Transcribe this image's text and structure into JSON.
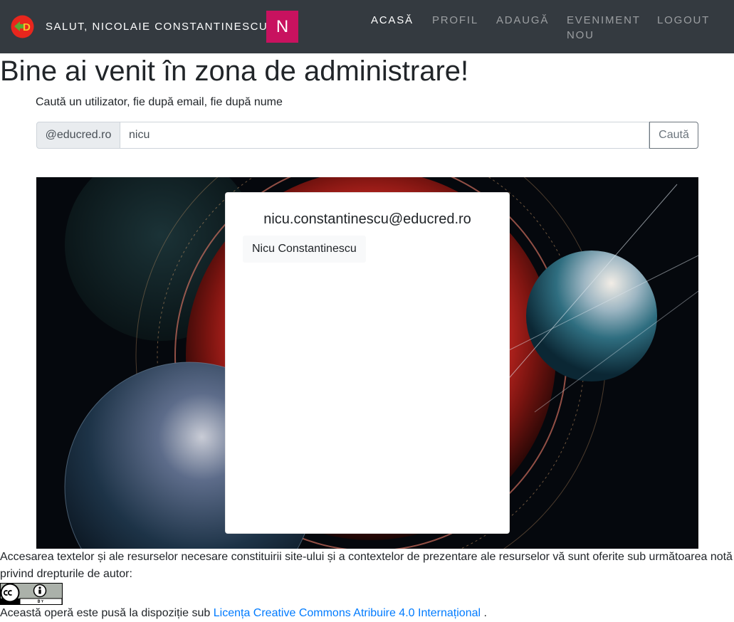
{
  "header": {
    "logo_icon": "educred-logo-icon",
    "greeting": "SALUT, NICOLAIE CONSTANTINESCU",
    "avatar_letter": "N",
    "avatar_color": "#c8125f",
    "nav": {
      "acasa": "ACASĂ",
      "profil": "PROFIL",
      "adauga": "ADAUGĂ",
      "eveniment_nou": "EVENIMENT NOU",
      "logout": "LOGOUT"
    }
  },
  "main": {
    "title": "Bine ai venit în zona de administrare!",
    "search_label": "Caută un utilizator, fie după email, fie după nume",
    "search": {
      "prefix": "@educred.ro",
      "value": "nicu",
      "button": "Caută"
    },
    "result": {
      "email": "nicu.constantinescu@educred.ro",
      "name": "Nicu Constantinescu"
    }
  },
  "footer": {
    "notice": "Accesarea textelor și ale resurselor necesare constituirii site-ului și a contextelor de prezentare ale resurselor vă sunt oferite sub următoarea notă privind drepturile de autor:",
    "badge_icon": "cc-by-license-icon",
    "license_prefix": "Această operă este pusă la dispoziție sub",
    "license_link": "Licența Creative Commons Atribuire 4.0 Internațional",
    "license_suffix": "."
  },
  "colors": {
    "navbar": "#343a40",
    "link": "#007bff"
  }
}
